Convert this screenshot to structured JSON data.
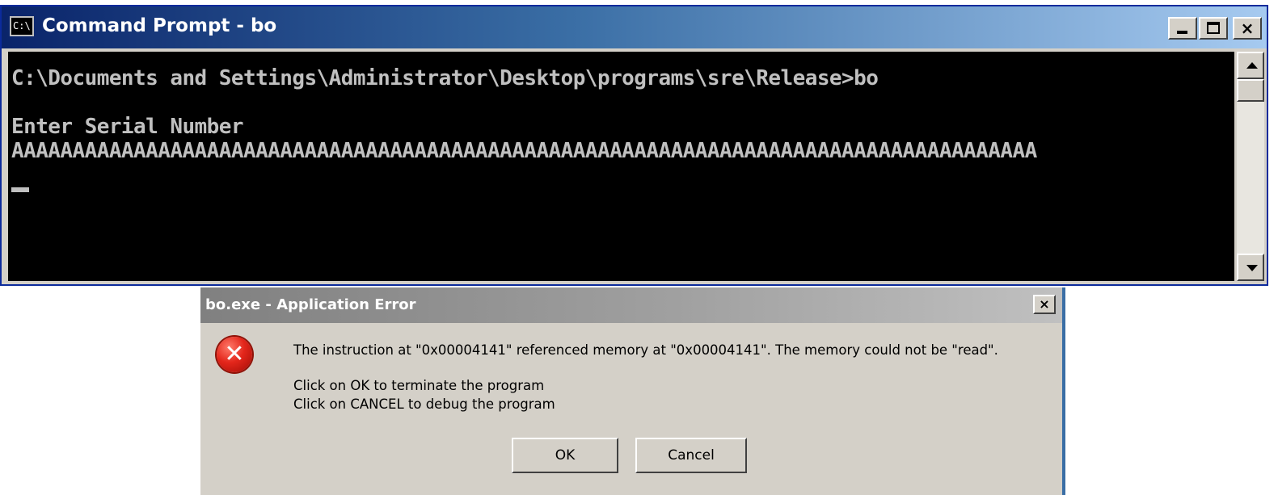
{
  "cmd_window": {
    "icon_text": "C:\\",
    "title": "Command Prompt - bo",
    "console_lines": [
      "C:\\Documents and Settings\\Administrator\\Desktop\\programs\\sre\\Release>bo",
      "",
      "Enter Serial Number",
      "AAAAAAAAAAAAAAAAAAAAAAAAAAAAAAAAAAAAAAAAAAAAAAAAAAAAAAAAAAAAAAAAAAAAAAAAAAAAAAAAAAAA"
    ]
  },
  "dialog": {
    "title": "bo.exe - Application Error",
    "close_glyph": "×",
    "icon": "error-icon",
    "message": "The instruction at \"0x00004141\" referenced memory at \"0x00004141\". The memory could not be \"read\".",
    "line_ok": "Click on OK to terminate the program",
    "line_cancel": "Click on CANCEL to debug the program",
    "ok_label": "OK",
    "cancel_label": "Cancel"
  },
  "colors": {
    "title_active": "#0a246a",
    "title_inactive": "#808080",
    "console_bg": "#000000",
    "console_fg": "#c0c0c0",
    "dialog_bg": "#d4d0c8",
    "error_red": "#e3261b"
  }
}
